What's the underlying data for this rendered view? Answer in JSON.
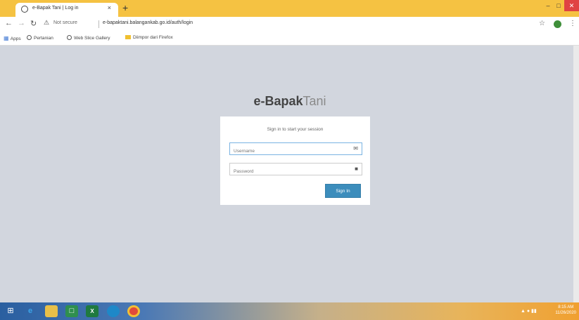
{
  "browser": {
    "tab_title": "e-Bapak Tani | Log in",
    "tab_close": "×",
    "new_tab": "+",
    "security_label": "Not secure",
    "url": "e-bapaktani.balangankab.go.id/auth/login",
    "bookmarks": [
      "Apps",
      "Pertanian",
      "Web Slice Gallery",
      "Diimpor dari Firefox"
    ]
  },
  "logo": {
    "bold": "e-Bapak",
    "light": "Tani"
  },
  "login": {
    "message": "Sign in to start your session",
    "username_placeholder": "Username",
    "password_placeholder": "Password",
    "signin_label": "Sign In"
  },
  "taskbar": {
    "time": "8:15 AM",
    "date": "11/26/2020"
  },
  "colors": {
    "accent": "#3c8dbc",
    "page_bg": "#d2d6de",
    "titlebar": "#f5c242"
  }
}
